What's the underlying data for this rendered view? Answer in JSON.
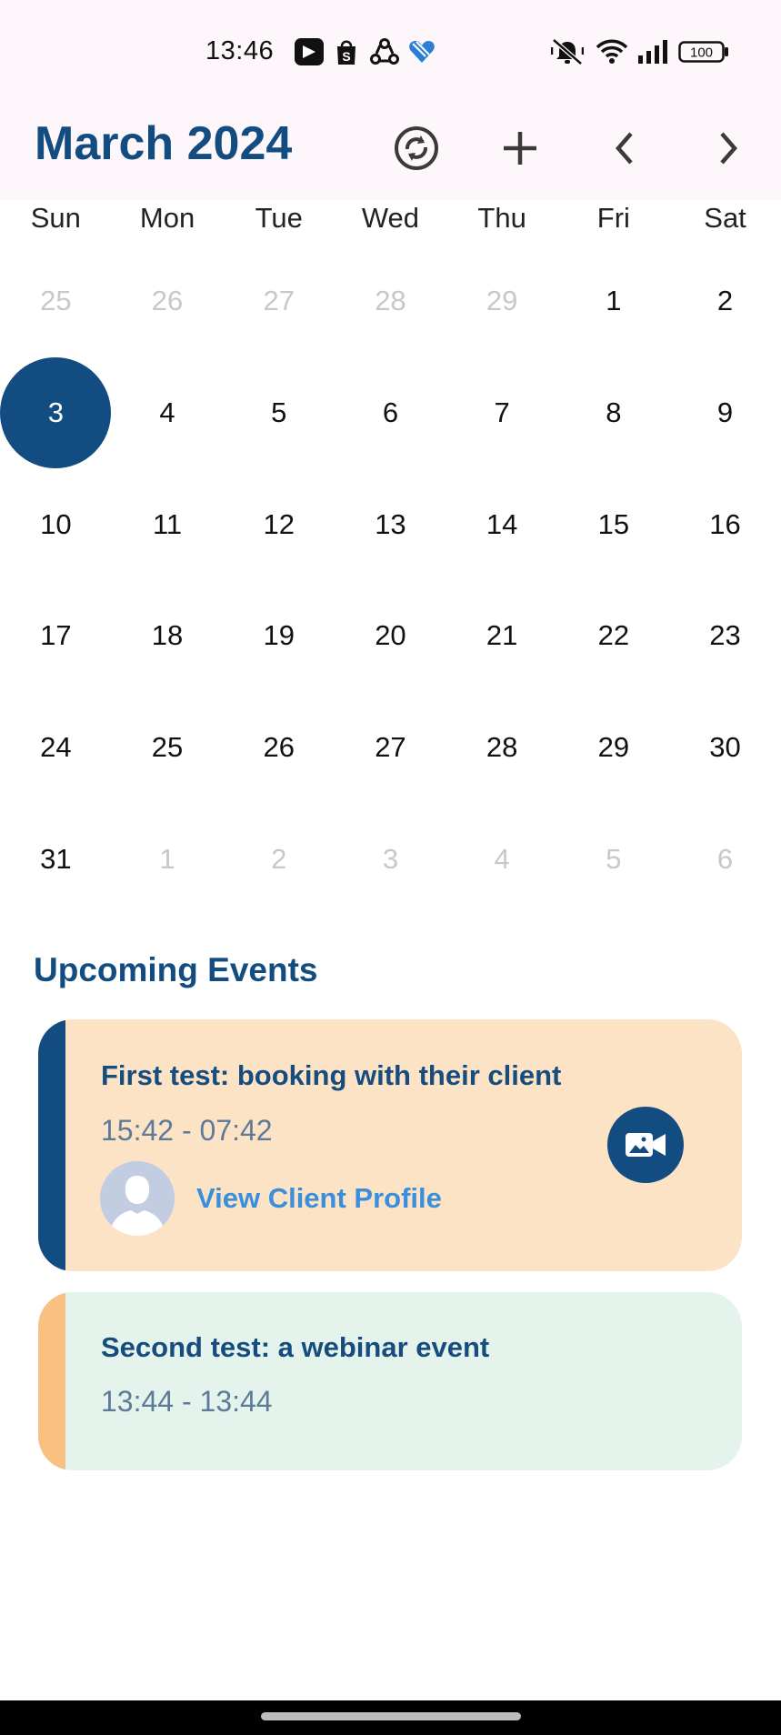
{
  "status_bar": {
    "time": "13:46",
    "battery": "100",
    "notification_icons": [
      "bilibili-icon",
      "shop-icon",
      "recycle-icon",
      "heart-icon"
    ],
    "system_icons": [
      "mute-icon",
      "wifi-icon",
      "signal-icon",
      "battery-icon"
    ]
  },
  "header": {
    "title": "March 2024",
    "buttons": [
      "sync-icon",
      "add-icon",
      "chevron-left-icon",
      "chevron-right-icon"
    ]
  },
  "calendar": {
    "weekdays": [
      "Sun",
      "Mon",
      "Tue",
      "Wed",
      "Thu",
      "Fri",
      "Sat"
    ],
    "days": [
      {
        "label": "25",
        "muted": true
      },
      {
        "label": "26",
        "muted": true
      },
      {
        "label": "27",
        "muted": true
      },
      {
        "label": "28",
        "muted": true
      },
      {
        "label": "29",
        "muted": true
      },
      {
        "label": "1"
      },
      {
        "label": "2"
      },
      {
        "label": "3",
        "selected": true
      },
      {
        "label": "4"
      },
      {
        "label": "5"
      },
      {
        "label": "6"
      },
      {
        "label": "7"
      },
      {
        "label": "8"
      },
      {
        "label": "9"
      },
      {
        "label": "10"
      },
      {
        "label": "11"
      },
      {
        "label": "12"
      },
      {
        "label": "13"
      },
      {
        "label": "14"
      },
      {
        "label": "15"
      },
      {
        "label": "16"
      },
      {
        "label": "17"
      },
      {
        "label": "18"
      },
      {
        "label": "19"
      },
      {
        "label": "20"
      },
      {
        "label": "21"
      },
      {
        "label": "22"
      },
      {
        "label": "23"
      },
      {
        "label": "24"
      },
      {
        "label": "25"
      },
      {
        "label": "26"
      },
      {
        "label": "27"
      },
      {
        "label": "28"
      },
      {
        "label": "29"
      },
      {
        "label": "30"
      },
      {
        "label": "31"
      },
      {
        "label": "1",
        "muted": true
      },
      {
        "label": "2",
        "muted": true
      },
      {
        "label": "3",
        "muted": true
      },
      {
        "label": "4",
        "muted": true
      },
      {
        "label": "5",
        "muted": true
      },
      {
        "label": "6",
        "muted": true
      }
    ]
  },
  "upcoming": {
    "title": "Upcoming Events",
    "events": [
      {
        "title": "First test: booking with their client",
        "time": "15:42 - 07:42",
        "link": "View Client Profile",
        "bg": "#fde3c6",
        "stripe": "#124c80"
      },
      {
        "title": "Second test:  a webinar event",
        "time": "13:44 - 13:44",
        "bg": "#e4f4ec",
        "stripe": "#f8c081"
      }
    ]
  },
  "colors": {
    "primary": "#124c80",
    "link": "#3a8fdc",
    "muted_day": "#c8c8c8"
  }
}
